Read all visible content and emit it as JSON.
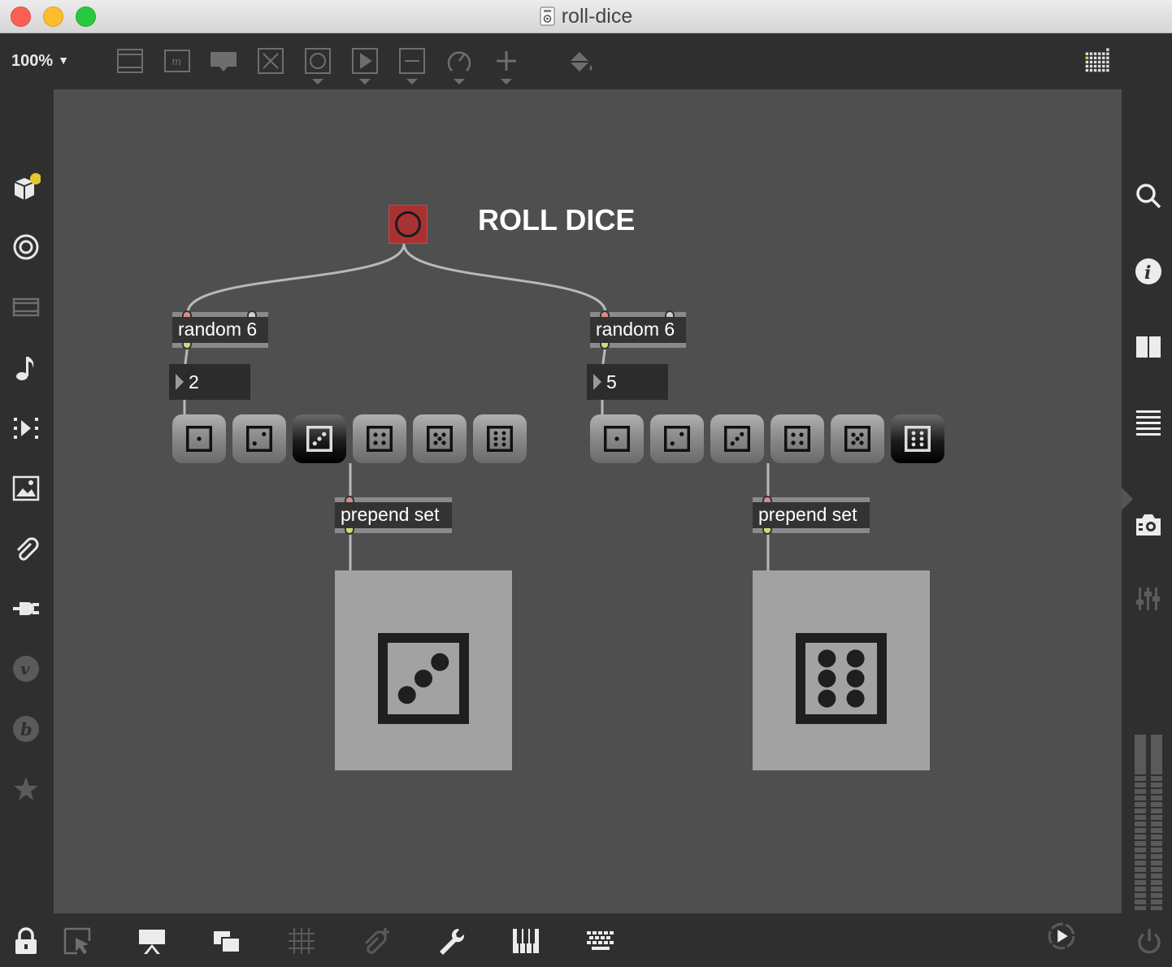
{
  "window": {
    "title": "roll-dice"
  },
  "toolbar": {
    "zoom": "100%",
    "icons": [
      "presentation-icon",
      "message-icon",
      "comment-icon",
      "toggle-icon",
      "button-icon",
      "slider-icon",
      "number-icon",
      "dial-icon",
      "add-icon",
      "paint-icon",
      "grid-icon"
    ]
  },
  "left_sidebar": {
    "icons": [
      "packages-icon",
      "target-icon",
      "video-icon",
      "music-note-icon",
      "playback-icon",
      "image-icon",
      "attachment-icon",
      "plugin-icon",
      "v-icon",
      "b-icon",
      "star-icon"
    ]
  },
  "right_sidebar": {
    "icons": [
      "search-icon",
      "info-icon",
      "panels-icon",
      "list-icon",
      "snapshot-icon",
      "mixer-icon"
    ]
  },
  "bottom_bar": {
    "icons": [
      "lock-icon",
      "select-icon",
      "presentation-icon",
      "windows-icon",
      "grid-icon",
      "attach-add-icon",
      "wrench-icon",
      "keyboard-icon",
      "computer-keyboard-icon",
      "audio-on-icon",
      "power-icon"
    ]
  },
  "patcher": {
    "comment": "ROLL DICE",
    "left": {
      "object": "random 6",
      "number": "2",
      "prepend": "prepend set",
      "selected_button": 3,
      "display_face": 3
    },
    "right": {
      "object": "random 6",
      "number": "5",
      "prepend": "prepend set",
      "selected_button": 6,
      "display_face": 6
    }
  },
  "colors": {
    "bang": "#a83232",
    "canvas": "#4f4f4f",
    "accent_yellow": "#e6c72a"
  }
}
